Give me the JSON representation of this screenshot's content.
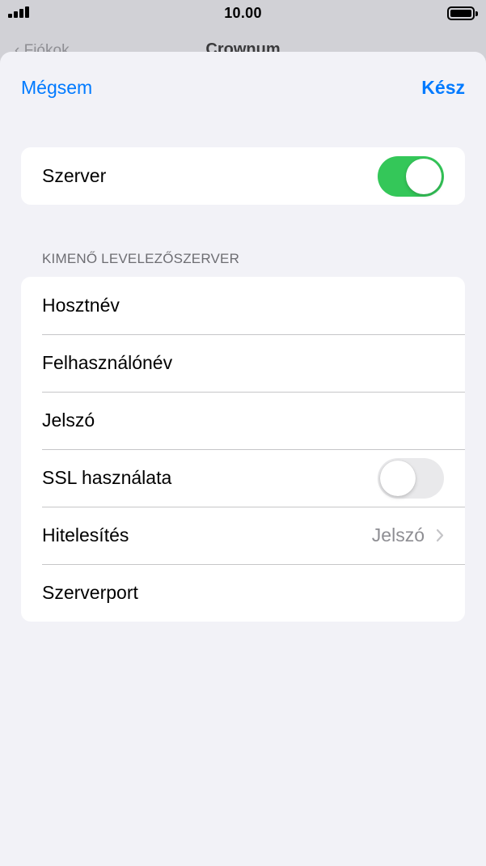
{
  "status_bar": {
    "time": "10.00"
  },
  "behind": {
    "back_label": "Fiókok",
    "title": "Crownum"
  },
  "header": {
    "cancel_label": "Mégsem",
    "done_label": "Kész"
  },
  "server_group": {
    "label": "Szerver",
    "toggle_on": true
  },
  "outgoing": {
    "section_title": "KIMENŐ LEVELEZŐSZERVER",
    "rows": [
      {
        "label": "Hosztnév"
      },
      {
        "label": "Felhasználónév"
      },
      {
        "label": "Jelszó"
      },
      {
        "label": "SSL használata",
        "toggle_on": false
      },
      {
        "label": "Hitelesítés",
        "value": "Jelszó"
      },
      {
        "label": "Szerverport"
      }
    ]
  },
  "colors": {
    "accent": "#007aff",
    "toggle_on": "#34c759",
    "background": "#f2f2f7"
  }
}
